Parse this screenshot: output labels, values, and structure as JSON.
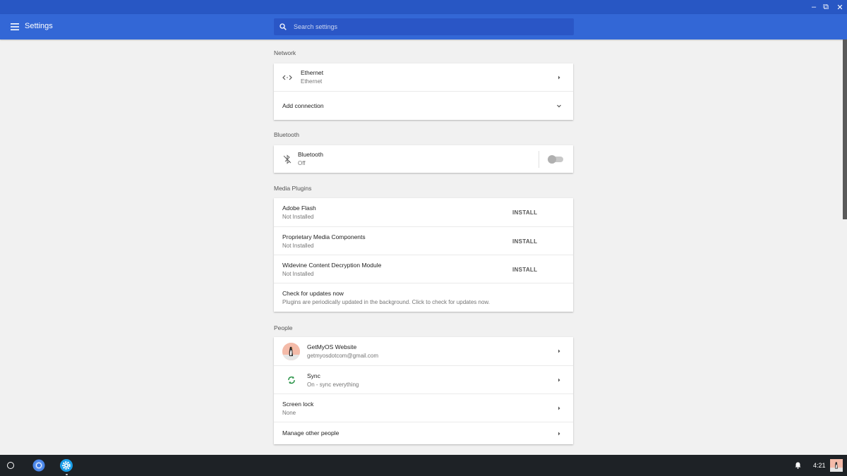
{
  "window": {
    "minimize_glyph": "–",
    "restore_glyph": "⧉",
    "close_glyph": "✕"
  },
  "appbar": {
    "title": "Settings",
    "search_placeholder": "Search settings"
  },
  "sections": {
    "network": {
      "title": "Network",
      "ethernet": {
        "label": "Ethernet",
        "status": "Ethernet"
      },
      "add_connection": "Add connection"
    },
    "bluetooth": {
      "title": "Bluetooth",
      "label": "Bluetooth",
      "status": "Off",
      "enabled": false
    },
    "media_plugins": {
      "title": "Media Plugins",
      "items": [
        {
          "label": "Adobe Flash",
          "status": "Not Installed",
          "action": "INSTALL"
        },
        {
          "label": "Proprietary Media Components",
          "status": "Not Installed",
          "action": "INSTALL"
        },
        {
          "label": "Widevine Content Decryption Module",
          "status": "Not Installed",
          "action": "INSTALL"
        }
      ],
      "check_updates": {
        "label": "Check for updates now",
        "description": "Plugins are periodically updated in the background. Click to check for updates now."
      }
    },
    "people": {
      "title": "People",
      "account": {
        "name": "GetMyOS Website",
        "email": "getmyosdotcom@gmail.com"
      },
      "sync": {
        "label": "Sync",
        "status": "On - sync everything"
      },
      "screen_lock": {
        "label": "Screen lock",
        "status": "None"
      },
      "manage_people": "Manage other people"
    }
  },
  "shelf": {
    "time": "4:21"
  },
  "colors": {
    "titlebar": "#2857c4",
    "appbar": "#3367d6",
    "search_bg": "#2a56c6",
    "background": "#f1f1f1",
    "shelf": "#1e2226",
    "sync_green": "#1e8e3e"
  },
  "icons": {
    "menu": "hamburger-menu-icon",
    "search": "search-icon",
    "ethernet": "ethernet-icon",
    "bluetooth": "bluetooth-disabled-icon",
    "sync": "sync-icon",
    "chevron_right": "chevron-right-icon",
    "chevron_down": "chevron-down-icon",
    "notification": "bell-icon"
  }
}
